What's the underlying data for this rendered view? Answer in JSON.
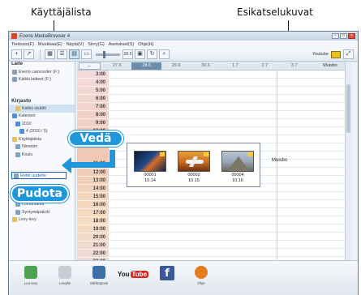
{
  "callouts": {
    "user_list": "Käyttäjälista",
    "thumbnails": "Esikatselukuvat",
    "drag": "Vedä",
    "drop": "Pudota"
  },
  "window": {
    "title": "Everio MediaBrowser 4",
    "minimize_icon": "minimize-icon",
    "maximize_icon": "maximize-icon",
    "close_icon": "close-icon"
  },
  "menubar": [
    "Tiedosto(F)",
    "Muokkaa(E)",
    "Näytä(V)",
    "Siirry(G)",
    "Asetukset(S)",
    "Ohje(H)"
  ],
  "toolbar": {
    "zoom_value": "28.5",
    "add_icon": "plus-icon",
    "view_icons": [
      "grid-view-icon",
      "list-view-icon",
      "calendar-view-icon"
    ],
    "upload_label": "Youtube"
  },
  "sidebar": {
    "section_library": "Kirjasto",
    "section_top": "Laite",
    "top_items": [
      "Everio camcorder (F:)",
      "Kaikki laitteet (F:)"
    ],
    "library_items": [
      {
        "label": "Kaikki sisältö",
        "level": 1,
        "icon": "folder-icon",
        "selected": true
      },
      {
        "label": "Kalenteri",
        "level": 0,
        "icon": "calendar-icon"
      },
      {
        "label": "2010",
        "level": 1,
        "icon": "calendar-icon"
      },
      {
        "label": "4 (2010 / 5)",
        "level": 2,
        "icon": "calendar-icon"
      },
      {
        "label": "Käyttäjälista",
        "level": 0,
        "icon": "folder-icon"
      },
      {
        "label": "Nimetön",
        "level": 1,
        "icon": "user-icon"
      },
      {
        "label": "Koulu",
        "level": 1,
        "icon": "user-icon"
      }
    ],
    "drop_target_label": "Retki uudelle",
    "lower_items": [
      "Lomamatka",
      "Syntymäpäivät",
      "Levy-levy"
    ]
  },
  "main": {
    "prev_icon": "left-arrow-icon",
    "dates": [
      "27.6",
      "28.6",
      "29.6",
      "30.6",
      "1.7",
      "2.7",
      "3.7"
    ],
    "selected_date_index": 1,
    "memo_header": "Muistio",
    "hours": [
      "3:00",
      "4:00",
      "5:00",
      "6:00",
      "7:00",
      "8:00",
      "9:00",
      "10:00",
      "11:00",
      "12:00",
      "13:00",
      "14:00",
      "15:00",
      "16:00",
      "17:00",
      "18:00",
      "19:00",
      "20:00",
      "21:00",
      "22:00",
      "23:00"
    ],
    "memo_text": "Muistio",
    "thumbnails": [
      {
        "number": "00001",
        "time": "10.14",
        "image": "sea-sunset"
      },
      {
        "number": "00002",
        "time": "10.15",
        "image": "airplane"
      },
      {
        "number": "00004",
        "time": "10.16",
        "image": "pyramid"
      }
    ]
  },
  "share_bar": {
    "buttons": [
      {
        "label": "Luo levy",
        "icon": "disc-create-icon"
      },
      {
        "label": "Levylle",
        "icon": "disc-icon"
      },
      {
        "label": "Sähköposti",
        "icon": "mail-icon"
      },
      {
        "label": "YouTube",
        "icon": "youtube-icon"
      },
      {
        "label": "Facebook",
        "icon": "facebook-icon"
      },
      {
        "label": "Ohje",
        "icon": "help-icon"
      }
    ],
    "youtube_you": "You",
    "youtube_tube": "Tube",
    "facebook_letter": "f"
  }
}
